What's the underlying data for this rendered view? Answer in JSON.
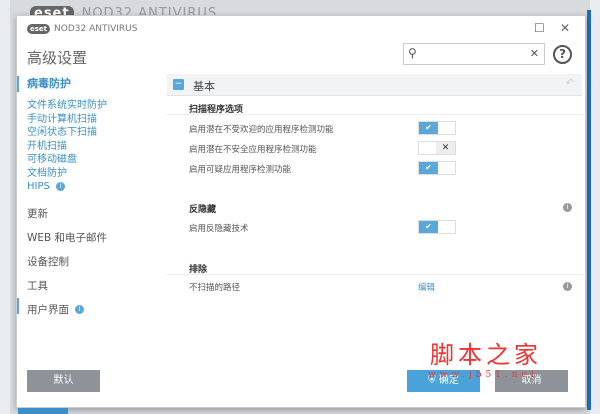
{
  "background_window": {
    "title": "NOD32 ANTIVIRUS",
    "logo": "eset"
  },
  "dialog": {
    "brand": "NOD32 ANTIVIRUS",
    "logo": "eset",
    "title": "高级设置",
    "search": {
      "value": "",
      "placeholder": ""
    },
    "help": "?"
  },
  "nav": {
    "active": "病毒防护",
    "sub": [
      "文件系统实时防护",
      "手动计算机扫描",
      "空闲状态下扫描",
      "开机扫描",
      "可移动磁盘",
      "文档防护",
      "HIPS"
    ],
    "hips_badge": "i",
    "top": [
      "更新",
      "WEB 和电子邮件",
      "设备控制",
      "工具",
      "用户界面"
    ],
    "ui_badge": "i"
  },
  "panel": {
    "header": "基本",
    "scanner": {
      "title": "扫描程序选项",
      "rows": [
        {
          "label": "启用潜在不受欢迎的应用程序检测功能",
          "on": true
        },
        {
          "label": "启用潜在不安全应用程序检测功能",
          "on": false
        },
        {
          "label": "启用可疑应用程序检测功能",
          "on": true
        }
      ]
    },
    "antistealth": {
      "title": "反隐藏",
      "rows": [
        {
          "label": "启用反隐藏技术",
          "on": true
        }
      ]
    },
    "exclusions": {
      "title": "排除",
      "row": "不扫描的路径",
      "link": "编辑"
    }
  },
  "buttons": {
    "default": "默认",
    "ok": "确定",
    "cancel": "取消"
  },
  "watermark": {
    "title": "脚本之家",
    "url": "www.jb51.net"
  },
  "colors": {
    "accent": "#4aa3d8",
    "button_gray": "#8e9399",
    "watermark": "#e33333"
  }
}
